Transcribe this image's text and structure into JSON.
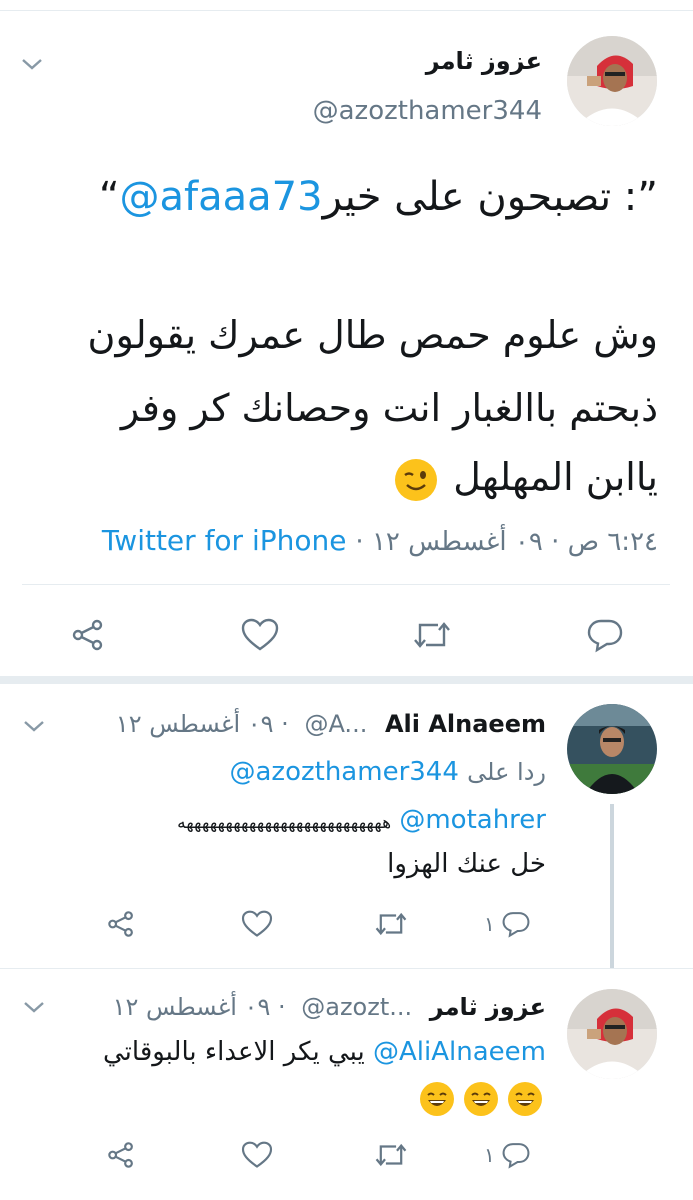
{
  "main_tweet": {
    "author_name": "عزوز ثامر",
    "author_handle": "@azozthamer344",
    "quote_open": "“",
    "quote_mention": "@afaaa73",
    "quote_text": ": تصبحون على خير",
    "quote_close": "”",
    "line1": "وش علوم حمص طال عمرك يقولون",
    "line2": "ذبحتم باالغبار انت وحصانك  كر وفر",
    "line3": "ياابن المهلهل",
    "emoji": "winking-face",
    "meta_time": "٦:٢٤ ص ·  ٠٩ أغسطس ١٢ ·",
    "source": "Twitter for iPhone"
  },
  "replies": [
    {
      "author_name": "Ali Alnaeem",
      "handle_trunc": "@A...",
      "date": "· ٠٩ أغسطس ١٢",
      "reply_to_label": "ردا على",
      "reply_to_handle": "@azozthamer344",
      "mention": "@motahrer",
      "laugh": "ههههههههههههههههههههههههههه",
      "line2": "خل عنك الهزوا",
      "reply_count": "١"
    },
    {
      "author_name": "عزوز ثامر",
      "handle_trunc": "@azozt...",
      "date": "· ٠٩ أغسطس ١٢",
      "mention": "@AliAlnaeem",
      "text": "يبي يكر الاعداء بالبوقاتي",
      "emoji": "grinning-face",
      "reply_count": "١"
    }
  ],
  "colors": {
    "link": "#1b95e0",
    "secondary": "#657786",
    "divider": "#e6ecf0",
    "emoji": "#fcc21b"
  }
}
